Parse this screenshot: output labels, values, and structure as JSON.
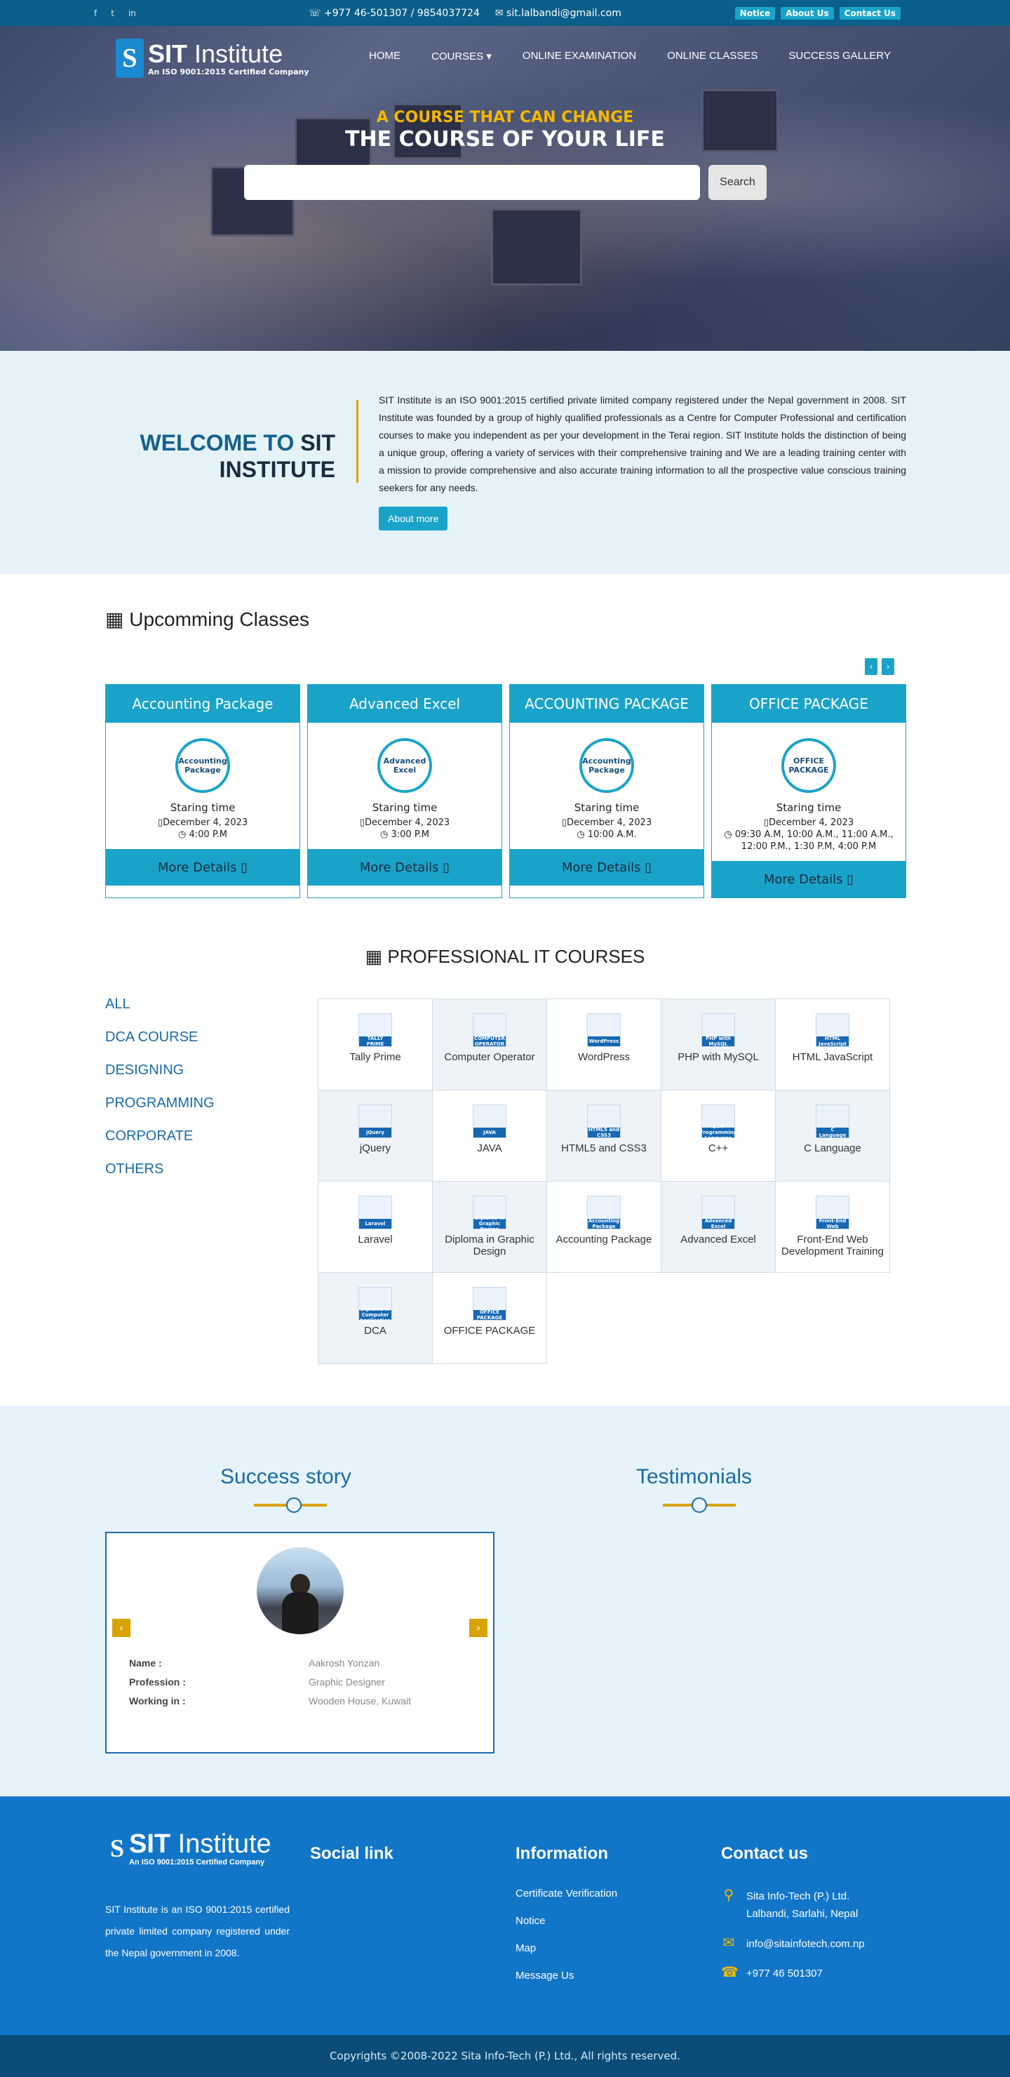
{
  "topbar": {
    "social": [
      "f",
      "t",
      "in"
    ],
    "phone": "☏ +977 46-501307 / 9854037724",
    "email": "✉ sit.lalbandi@gmail.com",
    "links": [
      "Notice",
      "About Us",
      "Contact Us"
    ]
  },
  "brand": {
    "name": "SIT Institute",
    "bold": "SIT",
    "rest": " Institute",
    "tagline": "An ISO 9001:2015 Certified Company",
    "mark": "S"
  },
  "nav": [
    "HOME",
    "COURSES ▾",
    "ONLINE EXAMINATION",
    "ONLINE CLASSES",
    "SUCCESS GALLERY"
  ],
  "hero": {
    "tagline": "A COURSE THAT CAN CHANGE",
    "headline": "THE COURSE OF YOUR LIFE",
    "search_placeholder": "",
    "search_button": "Search"
  },
  "welcome": {
    "title_a": "WELCOME TO",
    "title_b": "SIT",
    "title_c": "INSTITUTE",
    "body": "SIT Institute is an ISO 9001:2015 certified private limited company registered under the Nepal government in 2008. SIT Institute was founded by a group of highly qualified professionals as a Centre for Computer Professional and certification courses to make you independent as per your development in the Terai region. SIT Institute holds the distinction of being a unique group, offering a variety of services with their comprehensive training and We are a leading training center with a mission to provide comprehensive and also accurate training information to all the prospective value conscious training seekers for any needs.",
    "button": "About more"
  },
  "upcoming": {
    "title": "▦ Upcomming Classes",
    "prev": "‹",
    "next": "›",
    "cards": [
      {
        "name": "Accounting Package",
        "icon_label": "Accounting Package",
        "start_label": "Staring time",
        "date": "▯December 4, 2023",
        "time": "◷ 4:00 P.M",
        "button": "More Details ▯"
      },
      {
        "name": "Advanced Excel",
        "icon_label": "Advanced Excel",
        "start_label": "Staring time",
        "date": "▯December 4, 2023",
        "time": "◷ 3:00 P.M",
        "button": "More Details ▯"
      },
      {
        "name": "ACCOUNTING PACKAGE",
        "icon_label": "Accounting Package",
        "start_label": "Staring time",
        "date": "▯December 4, 2023",
        "time": "◷ 10:00 A.M.",
        "button": "More Details ▯"
      },
      {
        "name": "OFFICE PACKAGE",
        "icon_label": "OFFICE PACKAGE",
        "start_label": "Staring time",
        "date": "▯December 4, 2023",
        "time": "◷ 09:30 A.M, 10:00 A.M., 11:00 A.M., 12:00 P.M., 1:30 P.M, 4:00 P.M",
        "button": "More Details ▯"
      }
    ]
  },
  "courses": {
    "title": "▦ PROFESSIONAL IT COURSES",
    "categories": [
      "ALL",
      "DCA COURSE",
      "DESIGNING",
      "PROGRAMMING",
      "CORPORATE",
      "OTHERS"
    ],
    "items": [
      {
        "name": "Tally Prime",
        "badge": "TALLY PRIME"
      },
      {
        "name": "Computer Operator",
        "badge": "COMPUTER OPERATOR"
      },
      {
        "name": "WordPress",
        "badge": "WordPress"
      },
      {
        "name": "PHP with MySQL",
        "badge": "PHP with MySQL"
      },
      {
        "name": "HTML JavaScript",
        "badge": "HTML JavaScript"
      },
      {
        "name": "jQuery",
        "badge": "jQuery"
      },
      {
        "name": "JAVA",
        "badge": "JAVA"
      },
      {
        "name": "HTML5 and CSS3",
        "badge": "HTML5 and CSS3"
      },
      {
        "name": "C++",
        "badge": "C++ Programming Language"
      },
      {
        "name": "C Language",
        "badge": "C Language"
      },
      {
        "name": "Laravel",
        "badge": "Laravel"
      },
      {
        "name": "Diploma in Graphic Design",
        "badge": "Diploma in Graphic Design"
      },
      {
        "name": "Accounting Package",
        "badge": "Accounting Package"
      },
      {
        "name": "Advanced Excel",
        "badge": "Advanced Excel"
      },
      {
        "name": "Front-End Web Development Training",
        "badge": "Front-End Web"
      },
      {
        "name": "DCA",
        "badge": "Diploma in Computer Application"
      },
      {
        "name": "OFFICE PACKAGE",
        "badge": "OFFICE PACKAGE"
      }
    ]
  },
  "story": {
    "success_title": "Success story",
    "testimonials_title": "Testimonials",
    "prev": "‹",
    "next": "›",
    "labels": {
      "name": "Name :",
      "profession": "Profession :",
      "work": "Working in :"
    },
    "person": {
      "name": "Aakrosh Yonzan",
      "profession": "Graphic Designer",
      "work": "Wooden House, Kuwait"
    }
  },
  "footer": {
    "about": "SIT Institute is an ISO 9001:2015 certified private limited company registered under the Nepal government in 2008.",
    "social_title": "Social link",
    "info_title": "Information",
    "info_links": [
      "Certificate Verification",
      "Notice",
      "Map",
      "Message Us"
    ],
    "contact_title": "Contact us",
    "address_line1": "Sita Info-Tech (P.) Ltd.",
    "address_line2": "Lalbandi, Sarlahi, Nepal",
    "email": "info@sitainfotech.com.np",
    "phone": "+977 46 501307",
    "icons": [
      "map-pin",
      "envelope",
      "phone"
    ],
    "copyright": "Copyrights ©2008-2022 Sita Info-Tech (P.) Ltd., All rights reserved."
  },
  "colors": {
    "accent": "#1aa3c9",
    "brand_blue": "#1276c8",
    "gold": "#d6a300",
    "dark_bar": "#0b5f8a"
  }
}
